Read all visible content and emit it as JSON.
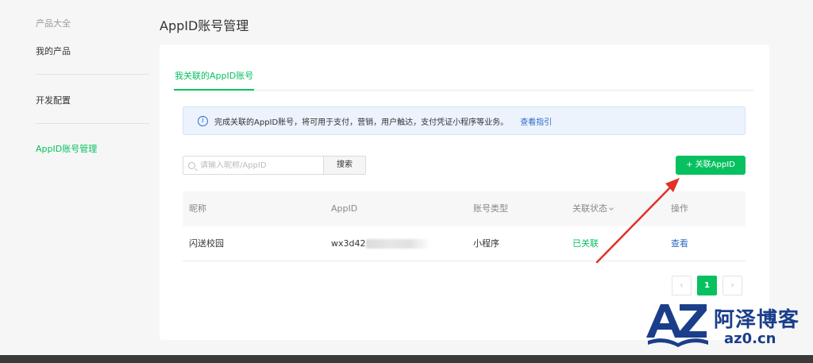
{
  "sidebar": {
    "group_title": "产品大全",
    "items": [
      {
        "label": "我的产品"
      },
      {
        "label": "开发配置"
      },
      {
        "label": "AppID账号管理"
      }
    ]
  },
  "page_title": "AppID账号管理",
  "tabs": [
    {
      "label": "我关联的AppID账号",
      "active": true
    }
  ],
  "notice": {
    "icon": "info-icon",
    "text": "完成关联的AppID账号，将可用于支付，营销，用户触达，支付凭证小程序等业务。",
    "link": "查看指引"
  },
  "search": {
    "placeholder": "请输入昵称/AppID",
    "value": "",
    "button_label": "搜索"
  },
  "add_button_label": "+ 关联AppID",
  "table": {
    "headers": [
      "昵称",
      "AppID",
      "账号类型",
      "关联状态",
      "操作"
    ],
    "rows": [
      {
        "nickname": "闪送校园",
        "appid": "wx3d42",
        "type": "小程序",
        "status": "已关联",
        "action": "查看"
      }
    ]
  },
  "pagination": {
    "prev": "‹",
    "current": "1",
    "next": "›"
  },
  "watermark": {
    "title": "阿泽博客",
    "sub": "az0.cn"
  },
  "colors": {
    "accent": "#07c160",
    "link": "#2d6bc7",
    "notice_bg": "#ecf3fd",
    "arrow": "#e0312b",
    "watermark": "#1b3e8a"
  }
}
